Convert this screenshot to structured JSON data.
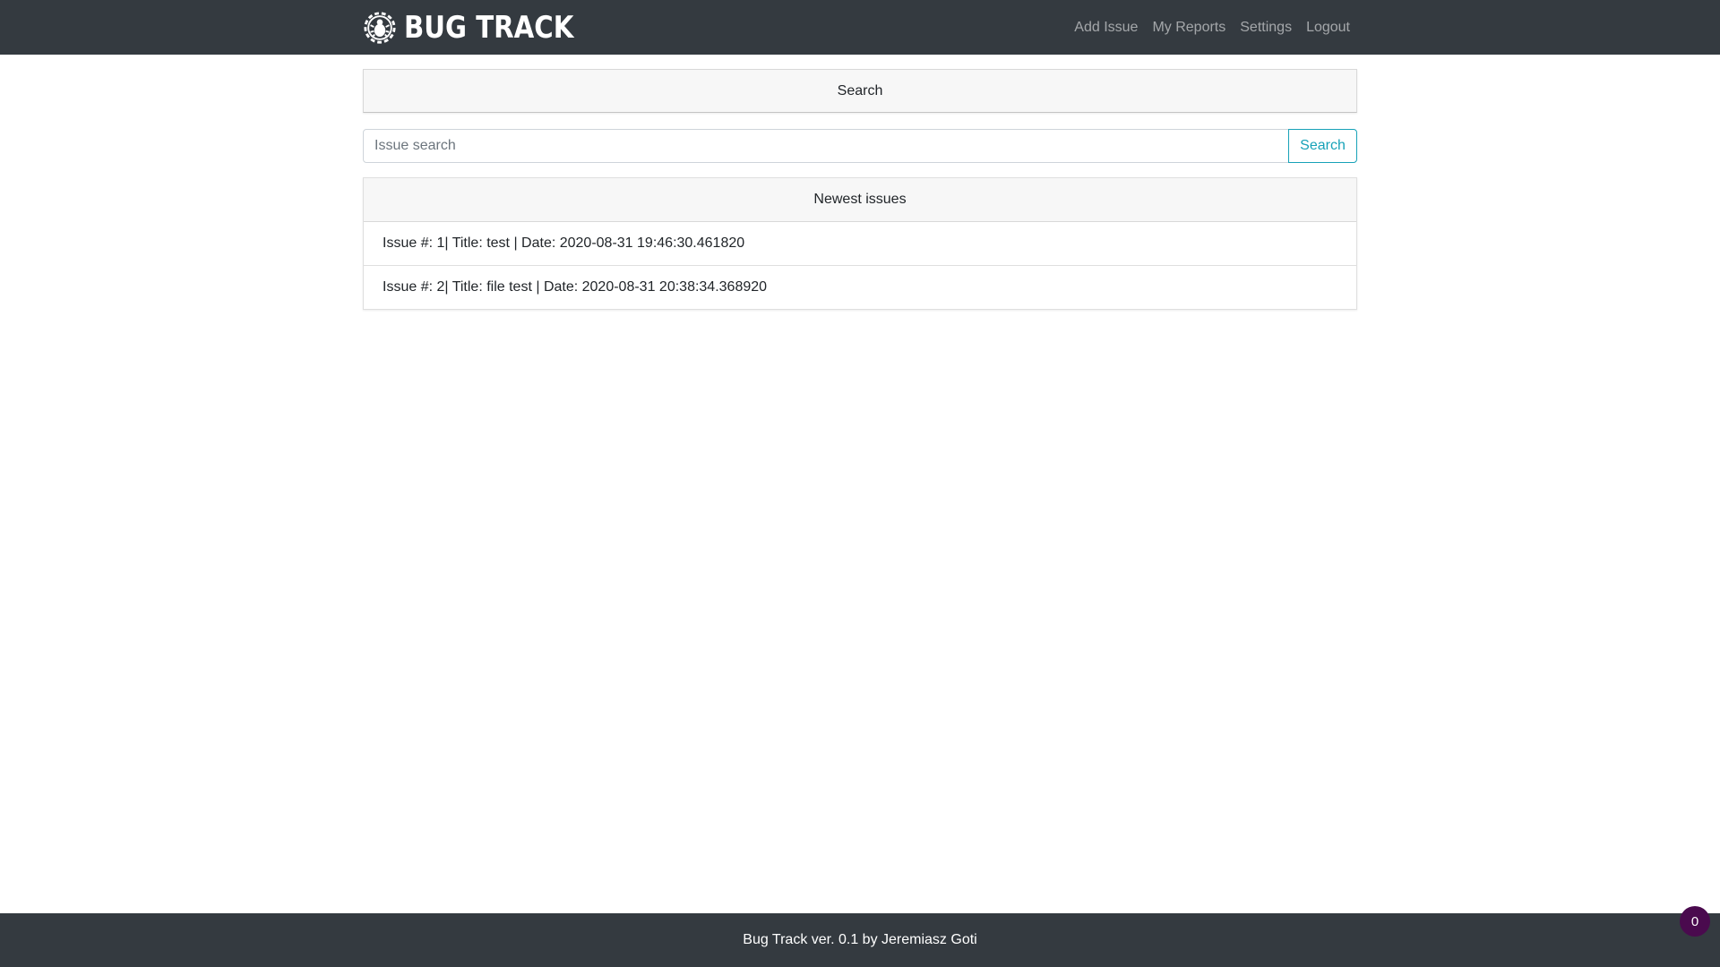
{
  "navbar": {
    "brand": "BUG TRACK",
    "brand_icon": "bug-gear-icon",
    "links": [
      "Add Issue",
      "My Reports",
      "Settings",
      "Logout"
    ]
  },
  "search_panel": {
    "header": "Search",
    "placeholder": "Issue search",
    "value": "",
    "button_label": "Search"
  },
  "issues_panel": {
    "header": "Newest issues",
    "items": [
      "Issue #: 1| Title: test | Date: 2020-08-31 19:46:30.461820",
      "Issue #: 2| Title: file test | Date: 2020-08-31 20:38:34.368920"
    ]
  },
  "footer": {
    "text": "Bug Track ver. 0.1 by Jeremiasz Goti"
  },
  "badge": {
    "count": "0"
  },
  "colors": {
    "navbar_bg": "#343a40",
    "accent": "#17a2b8",
    "badge_bg": "#4a0a4e"
  }
}
